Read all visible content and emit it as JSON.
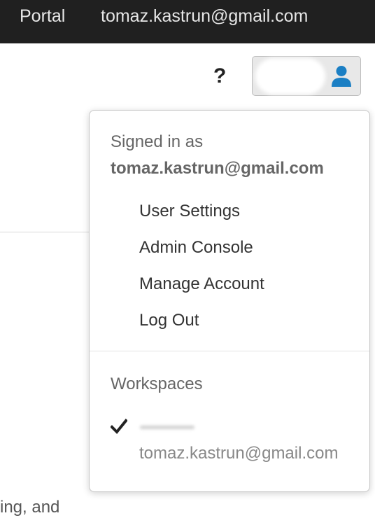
{
  "topbar": {
    "portal_label": "Portal",
    "email": "tomaz.kastrun@gmail.com"
  },
  "toolbar": {
    "help_label": "?"
  },
  "user_button": {
    "icon": "user-icon",
    "accent_color": "#1b7fc4"
  },
  "dropdown": {
    "signed_in_label": "Signed in as",
    "signed_in_email": "tomaz.kastrun@gmail.com",
    "items": [
      {
        "label": "User Settings"
      },
      {
        "label": "Admin Console"
      },
      {
        "label": "Manage Account"
      },
      {
        "label": "Log Out"
      }
    ],
    "workspaces_label": "Workspaces",
    "workspace": {
      "email": "tomaz.kastrun@gmail.com",
      "selected_icon": "check-icon"
    }
  },
  "background": {
    "partial_text": "ing, and"
  }
}
